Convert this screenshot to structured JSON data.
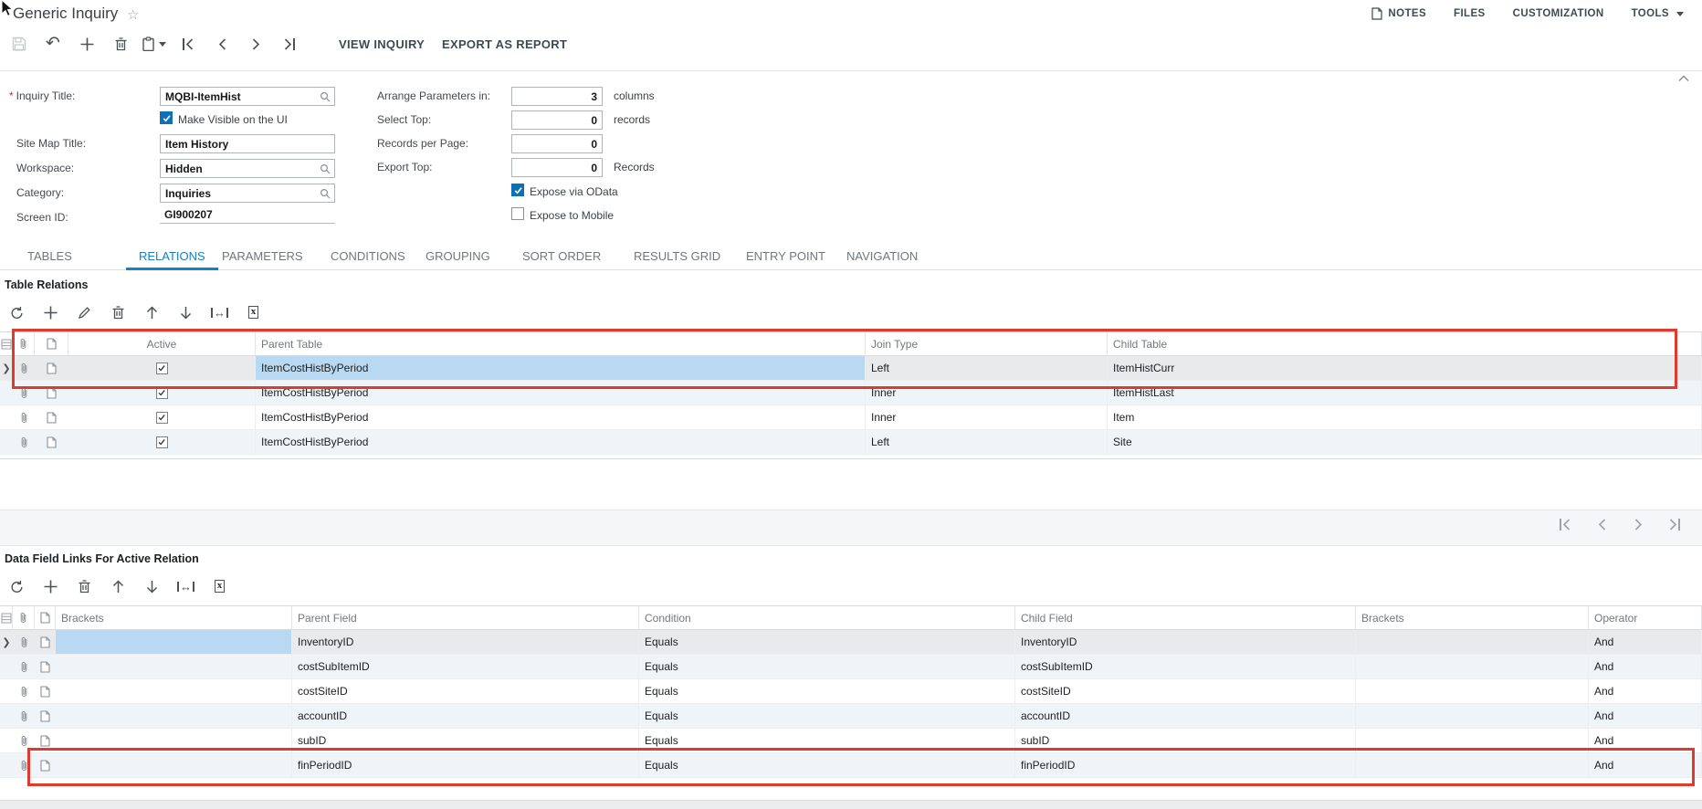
{
  "page": {
    "title": "Generic Inquiry"
  },
  "header_links": [
    {
      "label": "NOTES",
      "icon": "note-icon"
    },
    {
      "label": "FILES"
    },
    {
      "label": "CUSTOMIZATION"
    },
    {
      "label": "TOOLS",
      "caret": true
    }
  ],
  "main_toolbar": {
    "icons": [
      "save",
      "undo",
      "add",
      "delete",
      "clipboard",
      "first",
      "prev",
      "next",
      "last"
    ],
    "buttons": {
      "view_inquiry": "VIEW INQUIRY",
      "export_as_report": "EXPORT AS REPORT"
    }
  },
  "form": {
    "inquiry_title": {
      "label": "Inquiry Title:",
      "value": "MQBI-ItemHist",
      "required": true,
      "icon": "search-icon"
    },
    "make_visible": {
      "label": "Make Visible on the UI",
      "checked": true
    },
    "site_map_title": {
      "label": "Site Map Title:",
      "value": "Item History"
    },
    "workspace": {
      "label": "Workspace:",
      "value": "Hidden",
      "icon": "search-icon"
    },
    "category": {
      "label": "Category:",
      "value": "Inquiries",
      "icon": "search-icon"
    },
    "screen_id": {
      "label": "Screen ID:",
      "value": "GI900207"
    },
    "arrange_parameters": {
      "label": "Arrange Parameters in:",
      "value": "3",
      "suffix": "columns"
    },
    "select_top": {
      "label": "Select Top:",
      "value": "0",
      "suffix": "records"
    },
    "records_per_page": {
      "label": "Records per Page:",
      "value": "0",
      "suffix": ""
    },
    "export_top": {
      "label": "Export Top:",
      "value": "0",
      "suffix": "Records"
    },
    "expose_odata": {
      "label": "Expose via OData",
      "checked": true
    },
    "expose_mobile": {
      "label": "Expose to Mobile",
      "checked": false
    }
  },
  "tabs": [
    "TABLES",
    "RELATIONS",
    "PARAMETERS",
    "CONDITIONS",
    "GROUPING",
    "SORT ORDER",
    "RESULTS GRID",
    "ENTRY POINT",
    "NAVIGATION"
  ],
  "active_tab": "RELATIONS",
  "table_relations": {
    "title": "Table Relations",
    "toolbar_icons": [
      "refresh",
      "add",
      "edit",
      "delete",
      "move-up",
      "move-down",
      "fit-width",
      "export-excel"
    ],
    "columns": [
      "Active",
      "Parent Table",
      "Join Type",
      "Child Table"
    ],
    "rows": [
      {
        "active": true,
        "parent_table": "ItemCostHistByPeriod",
        "join_type": "Left",
        "child_table": "ItemHistCurr",
        "selected": true
      },
      {
        "active": true,
        "parent_table": "ItemCostHistByPeriod",
        "join_type": "Inner",
        "child_table": "ItemHistLast",
        "alt": true
      },
      {
        "active": true,
        "parent_table": "ItemCostHistByPeriod",
        "join_type": "Inner",
        "child_table": "Item"
      },
      {
        "active": true,
        "parent_table": "ItemCostHistByPeriod",
        "join_type": "Left",
        "child_table": "Site",
        "alt": true
      }
    ]
  },
  "pager": {
    "icons": [
      "first",
      "prev",
      "next",
      "last"
    ]
  },
  "data_field_links": {
    "title": "Data Field Links For Active Relation",
    "toolbar_icons": [
      "refresh",
      "add",
      "delete",
      "move-up",
      "move-down",
      "fit-width",
      "export-excel"
    ],
    "columns": [
      "Brackets",
      "Parent Field",
      "Condition",
      "Child Field",
      "Brackets",
      "Operator"
    ],
    "rows": [
      {
        "brackets": "",
        "parent_field": "InventoryID",
        "condition": "Equals",
        "child_field": "InventoryID",
        "brackets2": "",
        "operator": "And",
        "selected": true
      },
      {
        "brackets": "",
        "parent_field": "costSubItemID",
        "condition": "Equals",
        "child_field": "costSubItemID",
        "brackets2": "",
        "operator": "And",
        "alt": true
      },
      {
        "brackets": "",
        "parent_field": "costSiteID",
        "condition": "Equals",
        "child_field": "costSiteID",
        "brackets2": "",
        "operator": "And"
      },
      {
        "brackets": "",
        "parent_field": "accountID",
        "condition": "Equals",
        "child_field": "accountID",
        "brackets2": "",
        "operator": "And",
        "alt": true
      },
      {
        "brackets": "",
        "parent_field": "subID",
        "condition": "Equals",
        "child_field": "subID",
        "brackets2": "",
        "operator": "And"
      },
      {
        "brackets": "",
        "parent_field": "finPeriodID",
        "condition": "Equals",
        "child_field": "finPeriodID",
        "brackets2": "",
        "operator": "And",
        "alt": true,
        "annotated": true
      }
    ]
  },
  "colors": {
    "annotation_red": "#df3a2c",
    "accent_blue": "#1780c2",
    "selection_blue": "#b9d9f2",
    "checkbox_blue": "#0d6fb8"
  }
}
